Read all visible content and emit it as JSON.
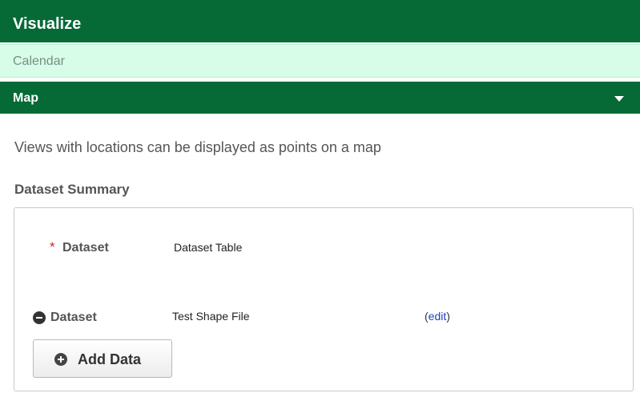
{
  "panel": {
    "title": "Visualize"
  },
  "calendar": {
    "label": "Calendar"
  },
  "map": {
    "label": "Map",
    "description": "Views with locations can be displayed as points on a map",
    "section_title": "Dataset Summary",
    "datasets": [
      {
        "required_marker": "*",
        "label": "Dataset",
        "value": "Dataset Table"
      },
      {
        "label": "Dataset",
        "value": "Test Shape File",
        "edit_open": "(",
        "edit_label": "edit",
        "edit_close": ")"
      }
    ],
    "add_data_label": "Add Data"
  },
  "colors": {
    "header_green": "#066a37",
    "calendar_bg": "#d7fde8",
    "required_red": "#cc2a2a",
    "link_blue": "#1b3fc4"
  },
  "icons": {
    "map_toggle": "caret-down-icon",
    "remove": "minus-circle-icon",
    "add": "plus-circle-icon"
  }
}
